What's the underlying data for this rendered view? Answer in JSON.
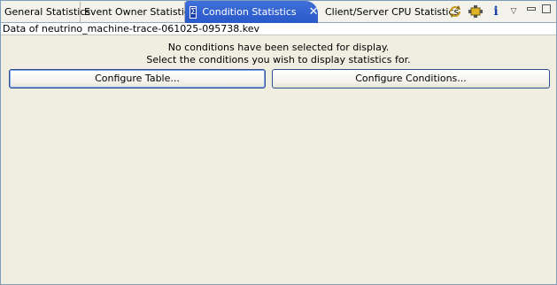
{
  "tabs": [
    {
      "label": "General Statistics"
    },
    {
      "label": "Event Owner Statistics"
    },
    {
      "label": "Condition Statistics",
      "active": true
    },
    {
      "label": "Client/Server CPU Statistics"
    }
  ],
  "toolbar": {
    "icons": [
      "sync-icon",
      "settings-icon",
      "info-icon",
      "view-menu-icon",
      "minimize-icon",
      "maximize-icon"
    ],
    "info_glyph": "i",
    "menu_glyph": "▽"
  },
  "subheader": {
    "text": "Data of neutrino_machine-trace-061025-095738.kev"
  },
  "message": {
    "line1": "No conditions have been selected for display.",
    "line2": "Select the conditions you wish to display statistics for."
  },
  "buttons": {
    "configure_table": "Configure Table...",
    "configure_conditions": "Configure Conditions..."
  },
  "colors": {
    "active_tab": "#2a59c9",
    "background": "#efeee1",
    "border": "#7f9db9"
  }
}
